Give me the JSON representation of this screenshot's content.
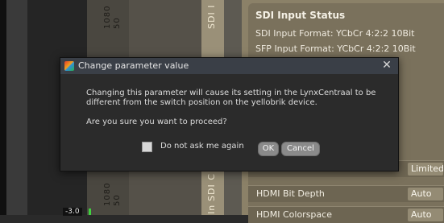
{
  "background": {
    "left_tags_top": [
      "1080",
      "50"
    ],
    "left_tags_bottom": [
      "1080",
      "50"
    ],
    "sdi_top": "SDI I",
    "sdi_bottom": "SDI C",
    "in_label": "In",
    "slider_value": "-3.0"
  },
  "status_panel": {
    "title": "SDI Input Status",
    "sdi_input_format": "SDI Input Format:  YCbCr 4:2:2 10Bit",
    "sfp_input_format": "SFP Input Format:  YCbCr 4:2:2 10Bit",
    "rows": [
      {
        "label": "",
        "value": "Limited"
      },
      {
        "label": "HDMI Bit Depth",
        "value": "Auto"
      },
      {
        "label": "HDMI Colorspace",
        "value": "Auto"
      }
    ]
  },
  "dialog": {
    "title": "Change parameter value",
    "close_symbol": "✕",
    "message": "Changing this parameter will cause its setting in the LynxCentraal to be different from the switch position on the yellobrik device.",
    "question": "Are you sure you want to proceed?",
    "checkbox_label": "Do not ask me again",
    "ok_label": "OK",
    "cancel_label": "Cancel"
  }
}
